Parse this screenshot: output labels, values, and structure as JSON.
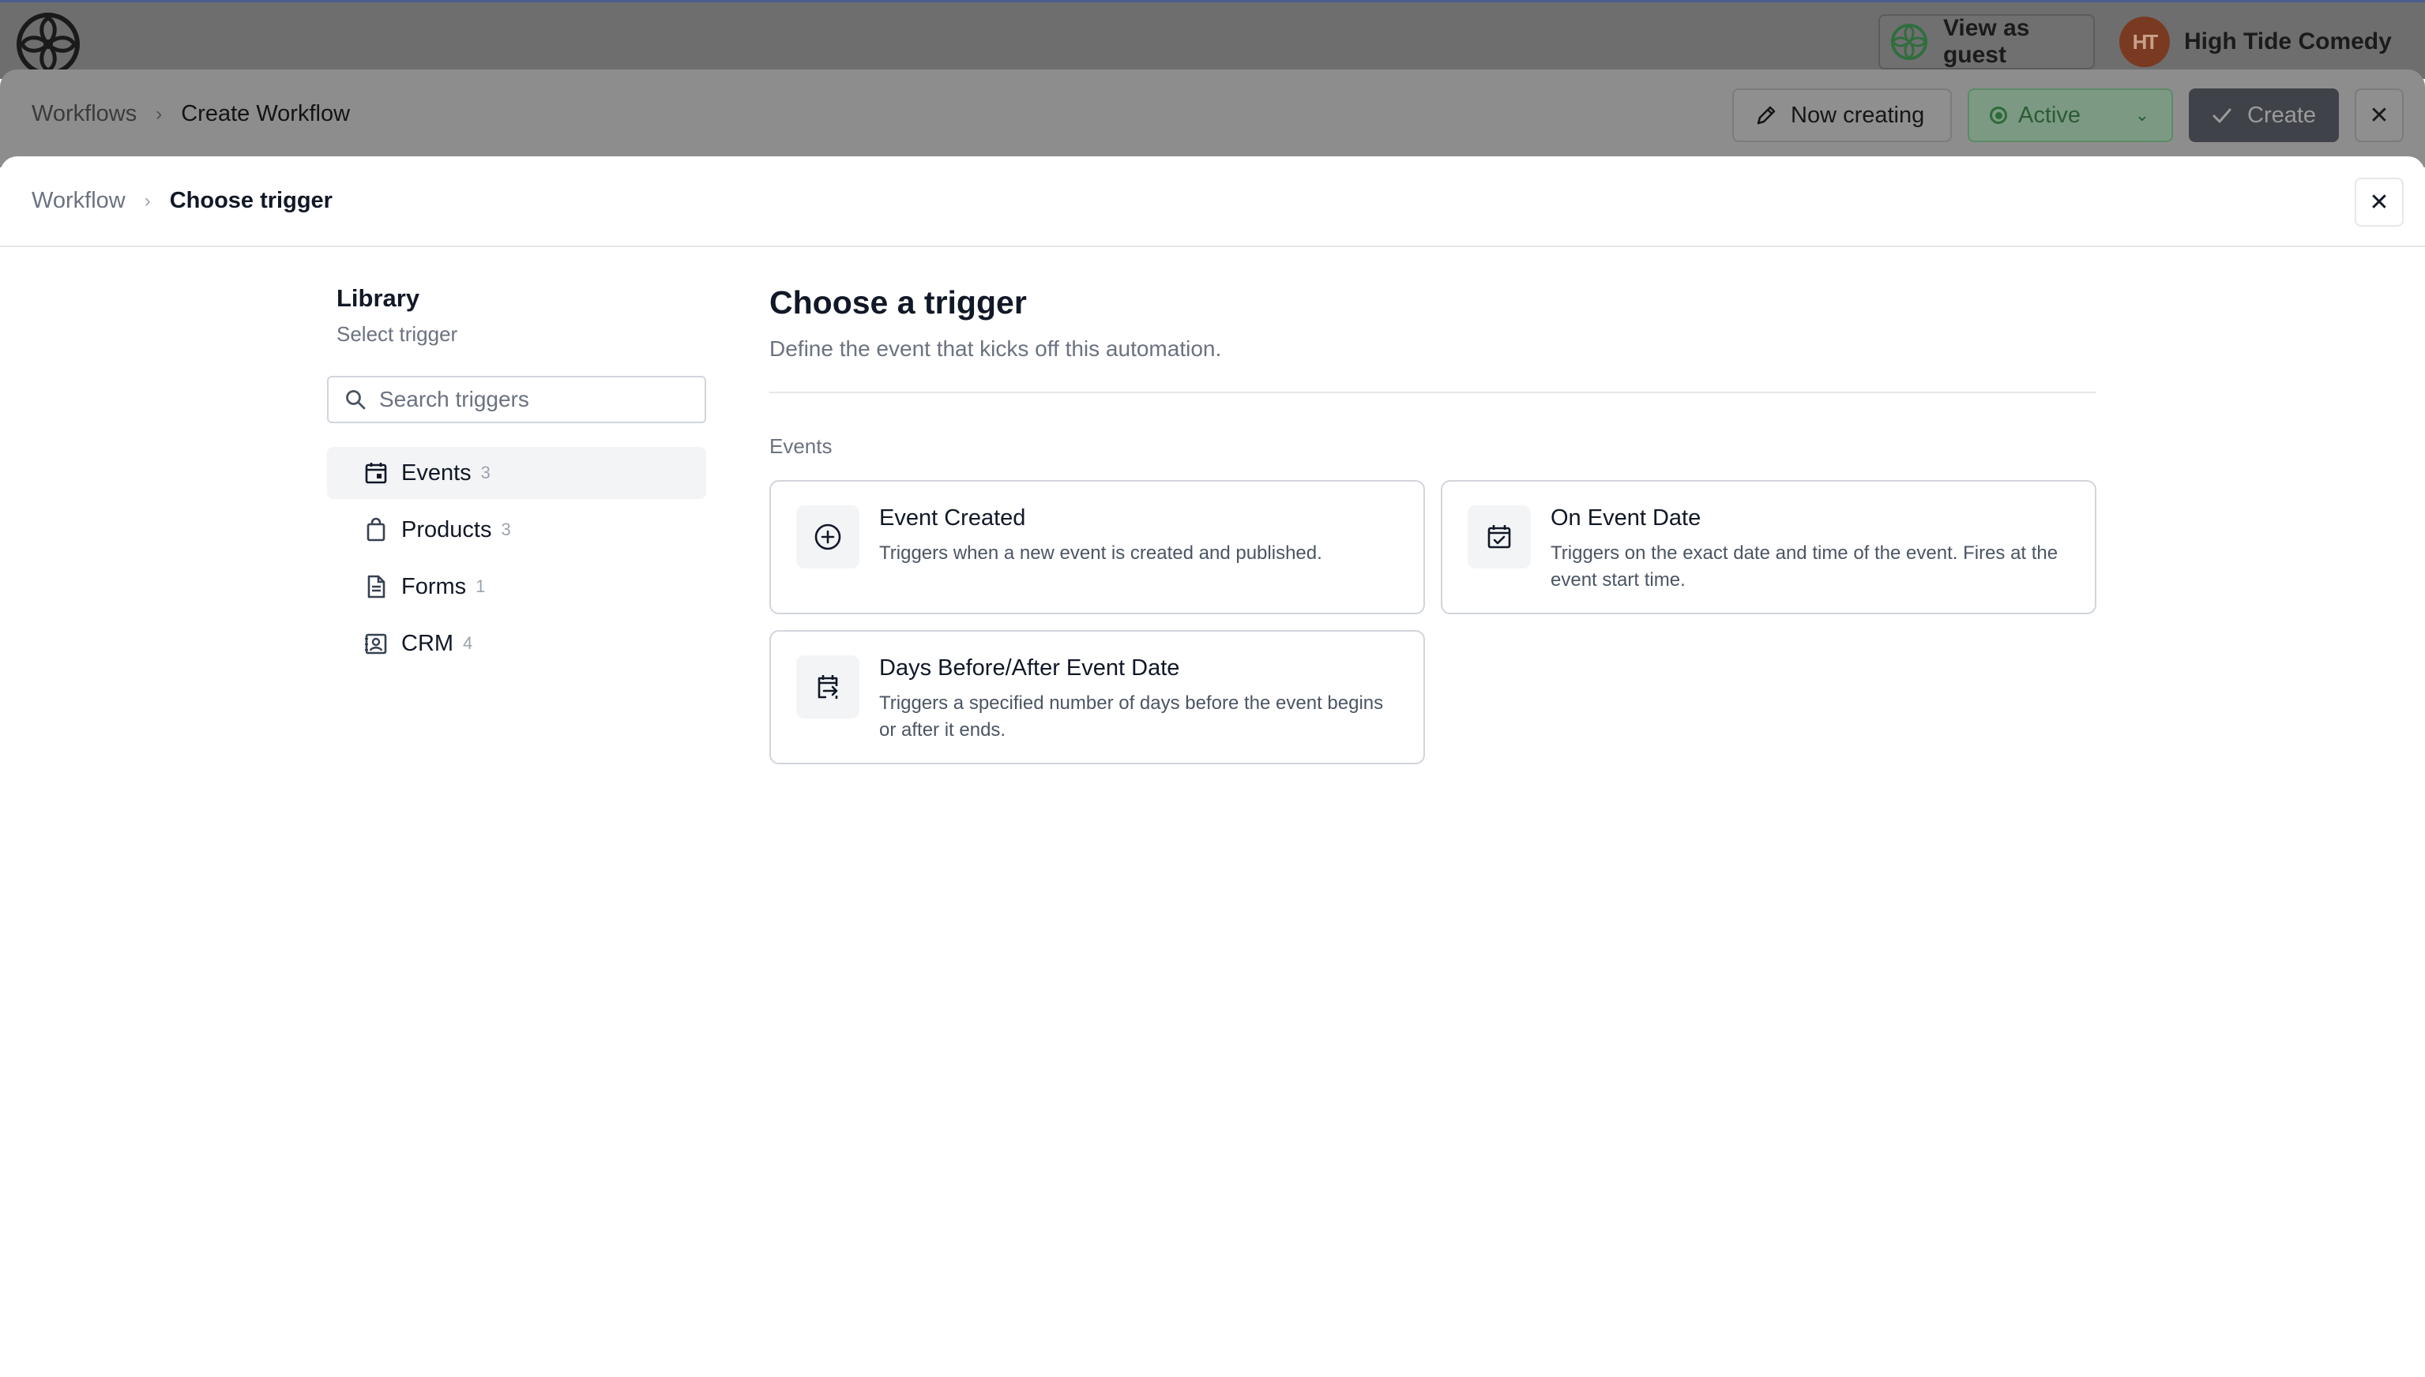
{
  "topbar": {
    "logo_icon": "app-logo-icon",
    "view_as_guest": "View as guest",
    "avatar_initials": "HT",
    "account_name": "High Tide Comedy"
  },
  "page_header": {
    "breadcrumb": {
      "parent": "Workflows",
      "current": "Create Workflow"
    },
    "now_creating": "Now creating",
    "status": "Active",
    "create": "Create",
    "status_color": "#2e6a3a"
  },
  "modal": {
    "breadcrumb": {
      "parent": "Workflow",
      "current": "Choose trigger"
    }
  },
  "library": {
    "title": "Library",
    "subtitle": "Select trigger",
    "search_placeholder": "Search triggers",
    "search_value": "",
    "categories": [
      {
        "label": "Events",
        "count": "3",
        "icon": "calendar-icon",
        "selected": true
      },
      {
        "label": "Products",
        "count": "3",
        "icon": "shopping-bag-icon",
        "selected": false
      },
      {
        "label": "Forms",
        "count": "1",
        "icon": "document-icon",
        "selected": false
      },
      {
        "label": "CRM",
        "count": "4",
        "icon": "contact-card-icon",
        "selected": false
      }
    ]
  },
  "main": {
    "title": "Choose a trigger",
    "description": "Define the event that kicks off this automation.",
    "section": "Events",
    "triggers": [
      {
        "title": "Event Created",
        "description": "Triggers when a new event is created and published.",
        "icon": "plus-circle-icon"
      },
      {
        "title": "On Event Date",
        "description": "Triggers on the exact date and time of the event. Fires at the event start time.",
        "icon": "calendar-check-icon"
      },
      {
        "title": "Days Before/After Event Date",
        "description": "Triggers a specified number of days before the event begins or after it ends.",
        "icon": "calendar-arrow-icon"
      }
    ]
  }
}
